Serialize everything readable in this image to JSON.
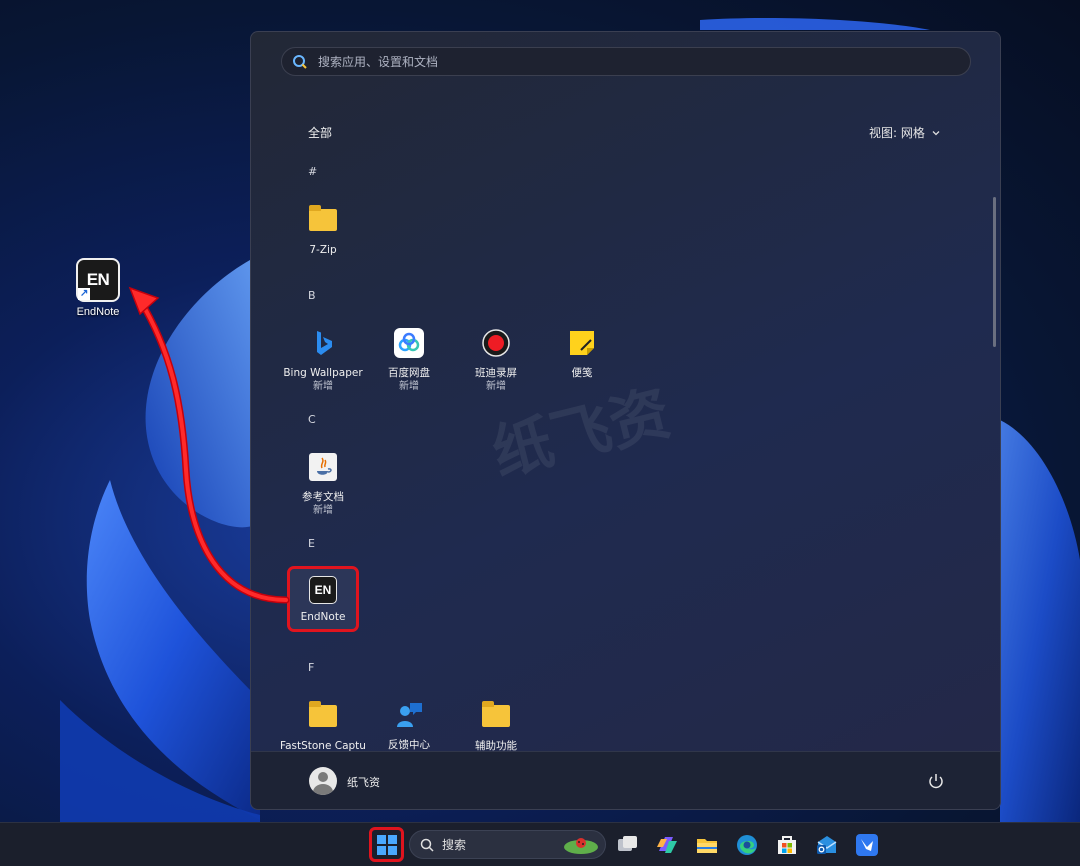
{
  "desktop": {
    "icons": [
      {
        "label": "EndNote",
        "tile_text": "EN"
      }
    ]
  },
  "start_menu": {
    "search": {
      "placeholder": "搜索应用、设置和文档"
    },
    "section_title": "全部",
    "view_button": "视图: 网格",
    "groups": [
      {
        "letter": "#",
        "apps": [
          {
            "name": "7-Zip",
            "sub": "",
            "icon": "folder-icon"
          }
        ]
      },
      {
        "letter": "B",
        "apps": [
          {
            "name": "Bing Wallpaper",
            "sub": "新增",
            "icon": "bing-icon"
          },
          {
            "name": "百度网盘",
            "sub": "新增",
            "icon": "baidu-netdisk-icon"
          },
          {
            "name": "班迪录屏",
            "sub": "新增",
            "icon": "bandicam-icon"
          },
          {
            "name": "便笺",
            "sub": "",
            "icon": "sticky-notes-icon"
          }
        ]
      },
      {
        "letter": "C",
        "apps": [
          {
            "name": "参考文档",
            "sub": "新增",
            "icon": "java-doc-icon"
          }
        ]
      },
      {
        "letter": "E",
        "apps": [
          {
            "name": "EndNote",
            "sub": "",
            "icon": "endnote-icon",
            "tile_text": "EN"
          }
        ]
      },
      {
        "letter": "F",
        "apps": [
          {
            "name": "FastStone Capture",
            "sub": "",
            "icon": "folder-icon"
          },
          {
            "name": "反馈中心",
            "sub": "",
            "icon": "feedback-hub-icon"
          },
          {
            "name": "辅助功能",
            "sub": "",
            "icon": "folder-icon"
          }
        ]
      }
    ],
    "footer": {
      "user_name": "纸飞资",
      "power_icon": "power-icon"
    }
  },
  "taskbar": {
    "search_label": "搜索",
    "icons": [
      "start-icon",
      "task-view-icon",
      "copilot-icon",
      "file-explorer-icon",
      "edge-icon",
      "store-icon",
      "outlook-icon",
      "feishu-icon"
    ]
  },
  "watermark": "纸飞资",
  "colors": {
    "highlight": "#e0141e",
    "folder": "#f6c43a",
    "accent": "#1c66d6"
  }
}
